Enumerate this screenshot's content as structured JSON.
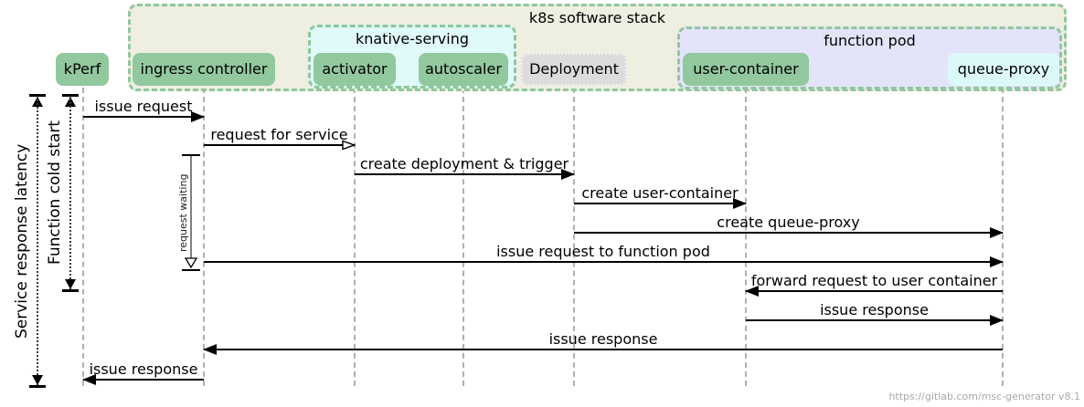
{
  "diagram": {
    "tool_footer": "https://gitlab.com/msc-generator v8.1"
  },
  "groups": {
    "k8s": {
      "label": "k8s software stack"
    },
    "knative": {
      "label": "knative-serving"
    },
    "function_pod": {
      "label": "function pod"
    }
  },
  "participants": [
    {
      "id": "kperf",
      "label": "kPerf"
    },
    {
      "id": "ingress-controller",
      "label": "ingress controller"
    },
    {
      "id": "activator",
      "label": "activator"
    },
    {
      "id": "autoscaler",
      "label": "autoscaler"
    },
    {
      "id": "deployment",
      "label": "Deployment"
    },
    {
      "id": "user-container",
      "label": "user-container"
    },
    {
      "id": "queue-proxy",
      "label": "queue-proxy"
    }
  ],
  "messages": [
    {
      "label": "issue request",
      "from": "kPerf",
      "to": "ingress controller",
      "direction": "right",
      "head": "filled"
    },
    {
      "label": "request for service",
      "from": "ingress controller",
      "to": "activator",
      "direction": "right",
      "head": "open"
    },
    {
      "label": "create deployment & trigger",
      "from": "activator",
      "to": "Deployment",
      "direction": "right",
      "head": "filled"
    },
    {
      "label": "create user-container",
      "from": "Deployment",
      "to": "user-container",
      "direction": "right",
      "head": "filled"
    },
    {
      "label": "create queue-proxy",
      "from": "Deployment",
      "to": "queue-proxy",
      "direction": "right",
      "head": "filled"
    },
    {
      "label": "issue request to function pod",
      "from": "ingress controller",
      "to": "queue-proxy",
      "direction": "right",
      "head": "filled"
    },
    {
      "label": "forward request to user container",
      "from": "queue-proxy",
      "to": "user-container",
      "direction": "left",
      "head": "filled"
    },
    {
      "label": "issue response",
      "from": "user-container",
      "to": "queue-proxy",
      "direction": "right",
      "head": "filled"
    },
    {
      "label": "issue response",
      "from": "queue-proxy",
      "to": "ingress controller",
      "direction": "left",
      "head": "filled"
    },
    {
      "label": "issue response",
      "from": "ingress controller",
      "to": "kPerf",
      "direction": "left",
      "head": "filled"
    }
  ],
  "measures": {
    "service_response_latency": "Service response latency",
    "function_cold_start": "Function cold start",
    "request_waiting": "request waiting"
  },
  "colors": {
    "participant_green": "#92c89e",
    "participant_gray": "#dcdcdc",
    "participant_cyan": "#dcf9f9",
    "group_border_green": "#8fc79b",
    "group_k8s_fill": "#eeeee1",
    "group_knative_fill": "#e0fafa",
    "group_function_pod_fill": "#e3e3fa",
    "lifeline_gray": "#b0b0b0",
    "footer_gray": "#a9a9a9"
  }
}
